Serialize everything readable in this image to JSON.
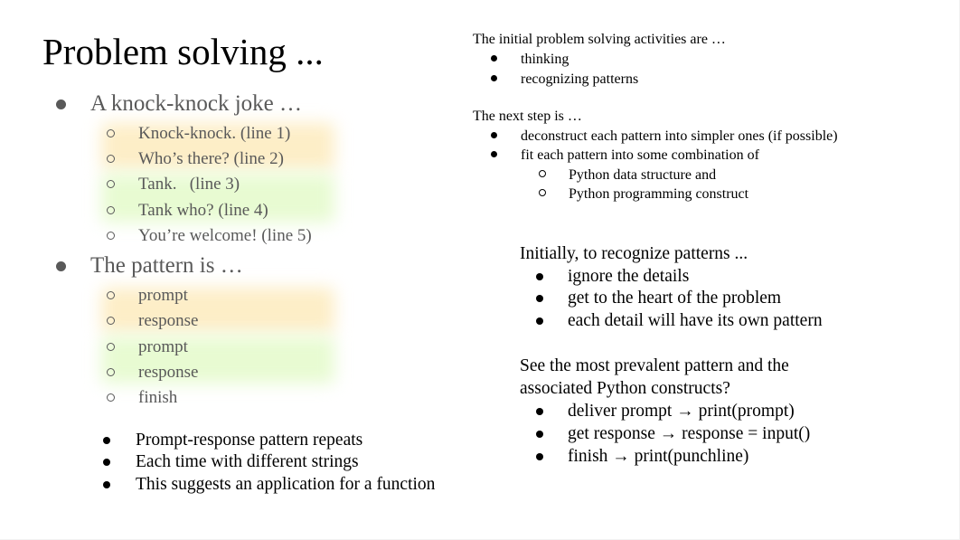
{
  "slide": {
    "title": "Problem solving ...",
    "left": {
      "section1": {
        "heading": "A knock-knock joke …",
        "lines": [
          "Knock-knock. (line 1)",
          "Who’s there? (line 2)",
          "Tank.   (line 3)",
          "Tank who? (line 4)",
          "You’re welcome! (line 5)"
        ]
      },
      "section2": {
        "heading": "The pattern is …",
        "lines": [
          "prompt",
          "response",
          "prompt",
          "response",
          "finish"
        ]
      },
      "observations": [
        "Prompt-response pattern repeats",
        "Each time with different strings",
        "This suggests an application for a function"
      ],
      "highlight_colors": {
        "orange": "#fdeec7",
        "green": "#e8fbd2"
      }
    },
    "right": {
      "initial": {
        "heading": "The initial problem solving activities are …",
        "items": [
          "thinking",
          "recognizing patterns"
        ]
      },
      "next": {
        "heading": "The next step is …",
        "items": [
          "deconstruct each pattern into simpler ones (if possible)",
          "fit each pattern into some combination of"
        ],
        "subitems": [
          "Python data structure and",
          "Python programming construct"
        ]
      },
      "recognize": {
        "heading": "Initially, to recognize patterns ...",
        "items": [
          "ignore the details",
          "get to the heart of the problem",
          "each detail will have its own pattern"
        ]
      },
      "prevalent": {
        "heading_line1": "See the most prevalent pattern and the",
        "heading_line2": "associated Python constructs?",
        "items": [
          "deliver prompt → print(prompt)",
          "get response → response = input()",
          "finish → print(punchline)"
        ]
      }
    }
  }
}
